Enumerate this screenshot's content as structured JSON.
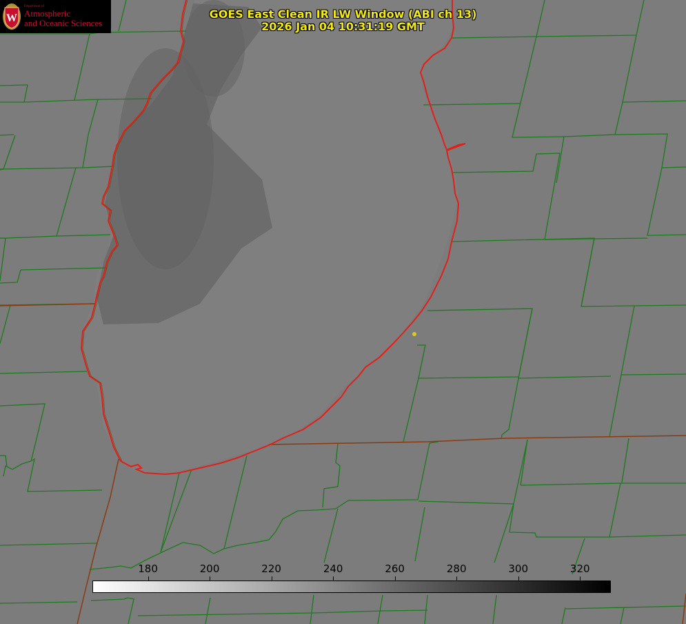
{
  "title": {
    "line1": "GOES East Clean IR LW Window (ABI ch 13)",
    "line2": "2026 Jan 04 10:31:19 GMT"
  },
  "logo": {
    "department": "Department of",
    "line1": "Atmospheric",
    "line2": "and Oceanic Sciences",
    "shield_letter": "W"
  },
  "colorbar": {
    "min": 162,
    "max": 330,
    "ticks": [
      "180",
      "200",
      "220",
      "240",
      "260",
      "280",
      "300",
      "320"
    ],
    "gradient": "white to black"
  },
  "colors": {
    "background": "#7c7c7c",
    "county_lines": "#1d7a1d",
    "coastline": "#e0201a",
    "title": "#f2ea18",
    "logo_red": "#c8102e",
    "marker": "#d8cc20"
  }
}
